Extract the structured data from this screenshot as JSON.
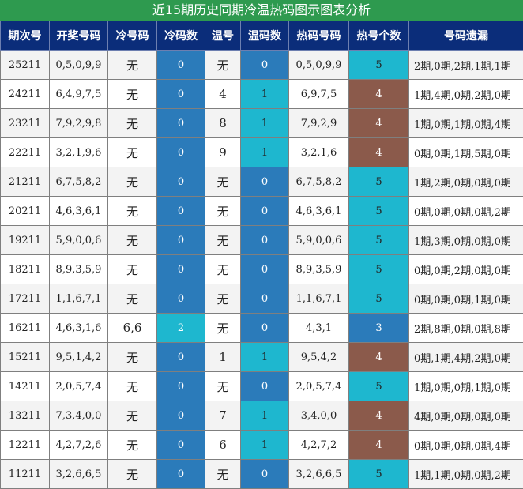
{
  "title": "近15期历史同期冷温热码图示图表分析",
  "headers": [
    "期次号",
    "开奖号码",
    "冷号码",
    "冷码数",
    "温号",
    "温码数",
    "热码号码",
    "热号个数",
    "号码遗漏"
  ],
  "rows": [
    {
      "issue": "25211",
      "draw": "0,5,0,9,9",
      "cold": "无",
      "cold_count": "0",
      "warm": "无",
      "warm_count": "0",
      "hot": "0,5,0,9,9",
      "hot_count": "5",
      "missing": "2期,0期,2期,1期,1期"
    },
    {
      "issue": "24211",
      "draw": "6,4,9,7,5",
      "cold": "无",
      "cold_count": "0",
      "warm": "4",
      "warm_count": "1",
      "hot": "6,9,7,5",
      "hot_count": "4",
      "missing": "1期,4期,0期,2期,0期"
    },
    {
      "issue": "23211",
      "draw": "7,9,2,9,8",
      "cold": "无",
      "cold_count": "0",
      "warm": "8",
      "warm_count": "1",
      "hot": "7,9,2,9",
      "hot_count": "4",
      "missing": "1期,0期,1期,0期,4期"
    },
    {
      "issue": "22211",
      "draw": "3,2,1,9,6",
      "cold": "无",
      "cold_count": "0",
      "warm": "9",
      "warm_count": "1",
      "hot": "3,2,1,6",
      "hot_count": "4",
      "missing": "0期,0期,1期,5期,0期"
    },
    {
      "issue": "21211",
      "draw": "6,7,5,8,2",
      "cold": "无",
      "cold_count": "0",
      "warm": "无",
      "warm_count": "0",
      "hot": "6,7,5,8,2",
      "hot_count": "5",
      "missing": "1期,2期,0期,0期,0期"
    },
    {
      "issue": "20211",
      "draw": "4,6,3,6,1",
      "cold": "无",
      "cold_count": "0",
      "warm": "无",
      "warm_count": "0",
      "hot": "4,6,3,6,1",
      "hot_count": "5",
      "missing": "0期,0期,0期,0期,2期"
    },
    {
      "issue": "19211",
      "draw": "5,9,0,0,6",
      "cold": "无",
      "cold_count": "0",
      "warm": "无",
      "warm_count": "0",
      "hot": "5,9,0,0,6",
      "hot_count": "5",
      "missing": "1期,3期,0期,0期,0期"
    },
    {
      "issue": "18211",
      "draw": "8,9,3,5,9",
      "cold": "无",
      "cold_count": "0",
      "warm": "无",
      "warm_count": "0",
      "hot": "8,9,3,5,9",
      "hot_count": "5",
      "missing": "0期,0期,2期,0期,0期"
    },
    {
      "issue": "17211",
      "draw": "1,1,6,7,1",
      "cold": "无",
      "cold_count": "0",
      "warm": "无",
      "warm_count": "0",
      "hot": "1,1,6,7,1",
      "hot_count": "5",
      "missing": "0期,0期,0期,1期,0期"
    },
    {
      "issue": "16211",
      "draw": "4,6,3,1,6",
      "cold": "6,6",
      "cold_count": "2",
      "warm": "无",
      "warm_count": "0",
      "hot": "4,3,1",
      "hot_count": "3",
      "missing": "2期,8期,0期,0期,8期"
    },
    {
      "issue": "15211",
      "draw": "9,5,1,4,2",
      "cold": "无",
      "cold_count": "0",
      "warm": "1",
      "warm_count": "1",
      "hot": "9,5,4,2",
      "hot_count": "4",
      "missing": "0期,1期,4期,2期,0期"
    },
    {
      "issue": "14211",
      "draw": "2,0,5,7,4",
      "cold": "无",
      "cold_count": "0",
      "warm": "无",
      "warm_count": "0",
      "hot": "2,0,5,7,4",
      "hot_count": "5",
      "missing": "1期,0期,0期,1期,0期"
    },
    {
      "issue": "13211",
      "draw": "7,3,4,0,0",
      "cold": "无",
      "cold_count": "0",
      "warm": "7",
      "warm_count": "1",
      "hot": "3,4,0,0",
      "hot_count": "4",
      "missing": "4期,0期,0期,0期,0期"
    },
    {
      "issue": "12211",
      "draw": "4,2,7,2,6",
      "cold": "无",
      "cold_count": "0",
      "warm": "6",
      "warm_count": "1",
      "hot": "4,2,7,2",
      "hot_count": "4",
      "missing": "0期,0期,0期,0期,4期"
    },
    {
      "issue": "11211",
      "draw": "3,2,6,6,5",
      "cold": "无",
      "cold_count": "0",
      "warm": "无",
      "warm_count": "0",
      "hot": "3,2,6,6,5",
      "hot_count": "5",
      "missing": "1期,1期,0期,0期,2期"
    }
  ]
}
